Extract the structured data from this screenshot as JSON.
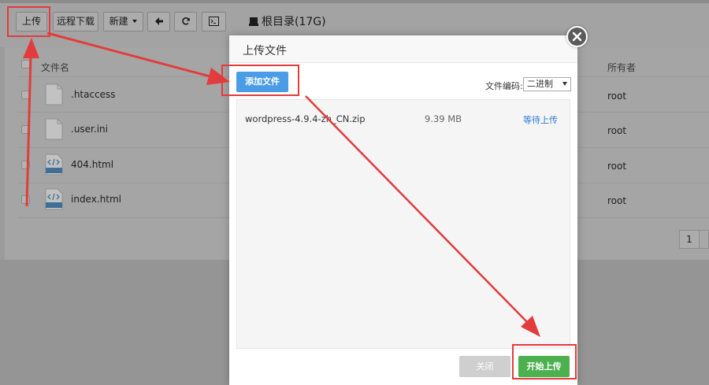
{
  "toolbar": {
    "upload_label": "上传",
    "remote_download_label": "远程下载",
    "new_label": "新建",
    "root_dir_label": "根目录(17G)"
  },
  "table": {
    "headers": {
      "name": "文件名",
      "owner": "所有者"
    },
    "rows": [
      {
        "name": ".htaccess",
        "owner": "root",
        "icon": "blank-file-icon"
      },
      {
        "name": ".user.ini",
        "owner": "root",
        "icon": "blank-file-icon"
      },
      {
        "name": "404.html",
        "owner": "root",
        "icon": "html-file-icon"
      },
      {
        "name": "index.html",
        "owner": "root",
        "icon": "html-file-icon"
      }
    ],
    "page": "1"
  },
  "modal": {
    "title": "上传文件",
    "add_file_label": "添加文件",
    "encoding_label": "文件编码:",
    "encoding_value": "二进制",
    "queue": [
      {
        "name": "wordpress-4.9.4-zh_CN.zip",
        "size": "9.39 MB",
        "status": "等待上传"
      }
    ],
    "close_label": "关闭",
    "start_label": "开始上传"
  },
  "colors": {
    "annotation_red": "#e23c3c",
    "add_button_blue": "#4b9ce6",
    "start_button_green": "#4cb04f"
  }
}
